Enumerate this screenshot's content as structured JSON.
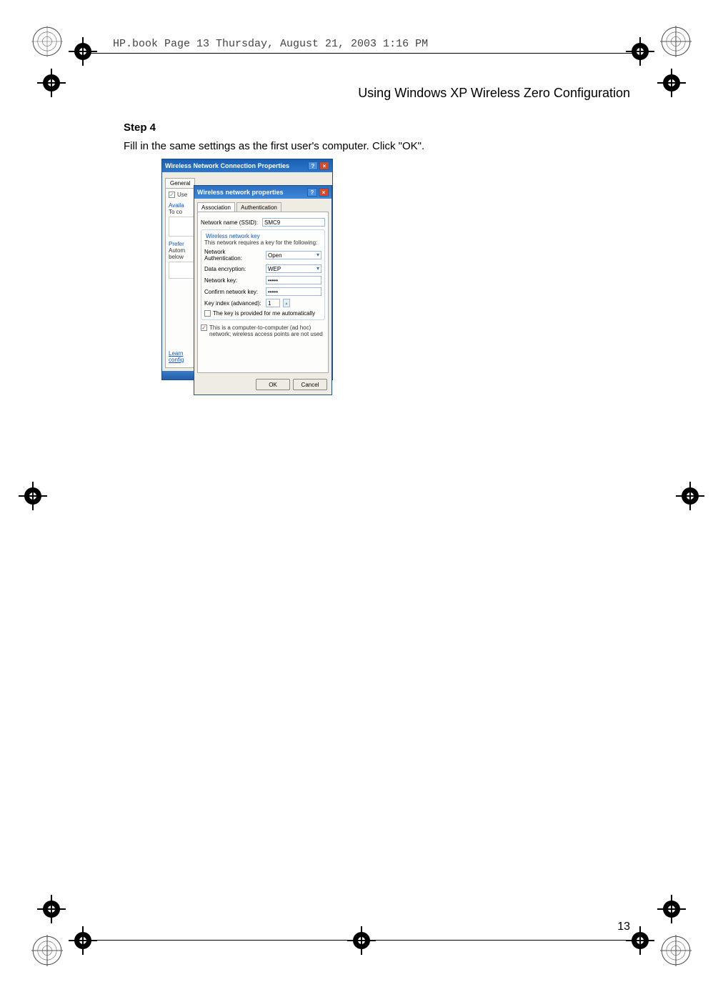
{
  "header_text": "HP.book  Page 13  Thursday, August 21, 2003  1:16 PM",
  "page_title": "Using Windows XP Wireless Zero Configuration",
  "step_label": "Step 4",
  "instruction": "Fill in the same settings as the first user's computer. Click \"OK\".",
  "page_number": "13",
  "outer_dialog": {
    "title": "Wireless Network Connection Properties",
    "help_btn": "?",
    "close_btn": "×",
    "tab_general": "General",
    "use_label": "Use",
    "available": "Availa",
    "to_co": "To co",
    "prefer": "Prefer",
    "auto": "Autom",
    "below": "below",
    "learn": "Learn",
    "config": "config"
  },
  "inner_dialog": {
    "title": "Wireless network properties",
    "help_btn": "?",
    "close_btn": "×",
    "tab_assoc": "Association",
    "tab_auth": "Authentication",
    "ssid_label": "Network name (SSID):",
    "ssid_value": "SMC9",
    "group_label": "Wireless network key",
    "group_note": "This network requires a key for the following:",
    "auth_label": "Network Authentication:",
    "auth_value": "Open",
    "enc_label": "Data encryption:",
    "enc_value": "WEP",
    "key_label": "Network key:",
    "key_value": "•••••",
    "confirm_label": "Confirm network key:",
    "confirm_value": "•••••",
    "index_label": "Key index (advanced):",
    "index_value": "1",
    "auto_key": "The key is provided for me automatically",
    "adhoc": "This is a computer-to-computer (ad hoc) network; wireless access points are not used",
    "ok": "OK",
    "cancel": "Cancel"
  }
}
